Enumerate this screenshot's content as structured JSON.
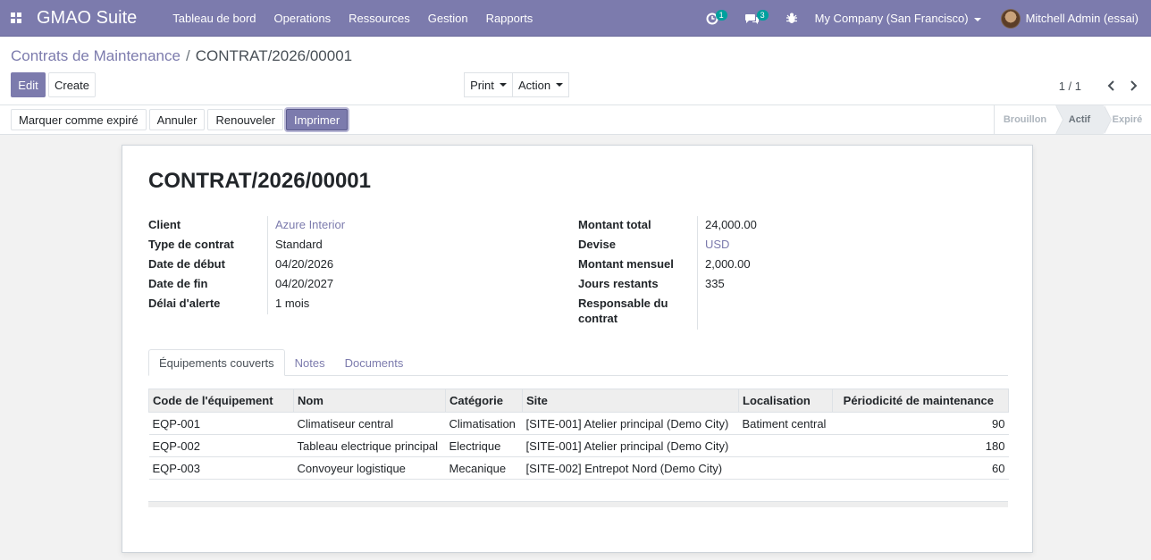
{
  "navbar": {
    "brand": "GMAO Suite",
    "menu": [
      "Tableau de bord",
      "Operations",
      "Ressources",
      "Gestion",
      "Rapports"
    ],
    "activity_count": "1",
    "message_count": "3",
    "company": "My Company (San Francisco)",
    "user": "Mitchell Admin (essai)"
  },
  "control_panel": {
    "breadcrumb_parent": "Contrats de Maintenance",
    "breadcrumb_current": "CONTRAT/2026/00001",
    "edit_label": "Edit",
    "create_label": "Create",
    "print_label": "Print",
    "action_label": "Action",
    "pager": "1 / 1"
  },
  "statusbar": {
    "buttons": [
      "Marquer comme expiré",
      "Annuler",
      "Renouveler",
      "Imprimer"
    ],
    "stages": [
      "Brouillon",
      "Actif",
      "Expiré"
    ],
    "active_stage": "Actif"
  },
  "record": {
    "title": "CONTRAT/2026/00001",
    "left_fields": [
      {
        "label": "Client",
        "value": "Azure Interior"
      },
      {
        "label": "Type de contrat",
        "value": "Standard"
      },
      {
        "label": "Date de début",
        "value": "04/20/2026"
      },
      {
        "label": "Date de fin",
        "value": "04/20/2027"
      },
      {
        "label": "Délai d'alerte",
        "value": "1 mois"
      }
    ],
    "right_fields": [
      {
        "label": "Montant total",
        "value": "24,000.00"
      },
      {
        "label": "Devise",
        "value": "USD"
      },
      {
        "label": "Montant mensuel",
        "value": "2,000.00"
      },
      {
        "label": "Jours restants",
        "value": "335"
      },
      {
        "label": "Responsable du contrat",
        "value": ""
      }
    ]
  },
  "tabs": [
    "Équipements couverts",
    "Notes",
    "Documents"
  ],
  "equipment_table": {
    "headers": [
      "Code de l'équipement",
      "Nom",
      "Catégorie",
      "Site",
      "Localisation",
      "Périodicité de maintenance"
    ],
    "rows": [
      [
        "EQP-001",
        "Climatiseur central",
        "Climatisation",
        "[SITE-001] Atelier principal (Demo City)",
        "Batiment central",
        "90"
      ],
      [
        "EQP-002",
        "Tableau electrique principal",
        "Electrique",
        "[SITE-001] Atelier principal (Demo City)",
        "",
        "180"
      ],
      [
        "EQP-003",
        "Convoyeur logistique",
        "Mecanique",
        "[SITE-002] Entrepot Nord (Demo City)",
        "",
        "60"
      ]
    ]
  },
  "colors": {
    "brand": "#7C7BAD",
    "link": "#7C7BAD",
    "badge": "#00A09D"
  }
}
